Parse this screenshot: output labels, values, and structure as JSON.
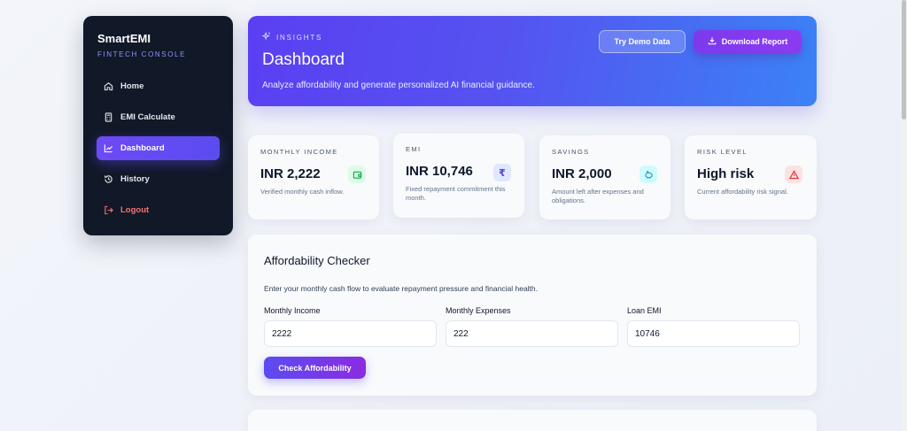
{
  "sidebar": {
    "brand": "SmartEMI",
    "subtitle": "FINTECH CONSOLE",
    "items": [
      {
        "label": "Home",
        "icon": "home-icon"
      },
      {
        "label": "EMI Calculate",
        "icon": "calculator-icon"
      },
      {
        "label": "Dashboard",
        "icon": "chart-line-icon",
        "active": true
      },
      {
        "label": "History",
        "icon": "history-icon"
      },
      {
        "label": "Logout",
        "icon": "logout-icon"
      }
    ]
  },
  "header": {
    "eyebrow": "INSIGHTS",
    "title": "Dashboard",
    "subtitle": "Analyze affordability and generate personalized AI financial guidance.",
    "demo_button": "Try Demo Data",
    "report_button": "Download Report"
  },
  "stats": [
    {
      "label": "MONTHLY INCOME",
      "value": "INR 2,222",
      "desc": "Verified monthly cash inflow.",
      "icon": "wallet-icon",
      "color": "#22c55e"
    },
    {
      "label": "EMI",
      "value": "INR 10,746",
      "desc": "Fixed repayment commitment this month.",
      "icon": "rupee-icon",
      "color": "#6366f1"
    },
    {
      "label": "SAVINGS",
      "value": "INR 2,000",
      "desc": "Amount left after expenses and obligations.",
      "icon": "piggy-bank-icon",
      "color": "#06b6d4"
    },
    {
      "label": "RISK LEVEL",
      "value": "High risk",
      "desc": "Current affordability risk signal.",
      "icon": "warning-icon",
      "color": "#ef4444"
    }
  ],
  "checker": {
    "title": "Affordability Checker",
    "description": "Enter your monthly cash flow to evaluate repayment pressure and financial health.",
    "fields": [
      {
        "label": "Monthly Income",
        "value": "2222"
      },
      {
        "label": "Monthly Expenses",
        "value": "222"
      },
      {
        "label": "Loan EMI",
        "value": "10746"
      }
    ],
    "button": "Check Affordability"
  },
  "colors": {
    "sidebar_bg": "#111827",
    "accent": "#5b4cf0",
    "brand_sub": "#8b95ff",
    "logout": "#f87171"
  }
}
